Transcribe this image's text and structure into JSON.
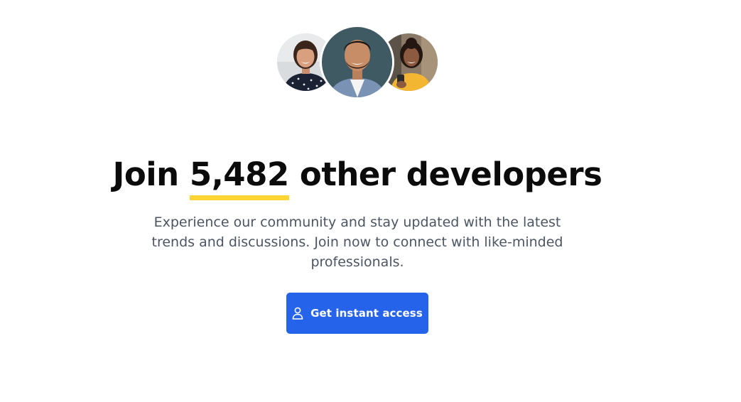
{
  "community": {
    "avatars": [
      {
        "name": "woman-smiling-avatar"
      },
      {
        "name": "man-smiling-avatar"
      },
      {
        "name": "woman-with-phone-avatar"
      }
    ],
    "headline": {
      "prefix": "Join ",
      "count": "5,482",
      "suffix": " other developers"
    },
    "description": "Experience our community and stay updated with the latest trends and discussions. Join now to connect with like-minded professionals.",
    "cta": {
      "label": "Get instant access",
      "icon": "user-icon"
    }
  },
  "colors": {
    "accent": "#2563eb",
    "highlight": "#fcd535",
    "heading": "#0b0b0b",
    "body_text": "#4b5563"
  }
}
